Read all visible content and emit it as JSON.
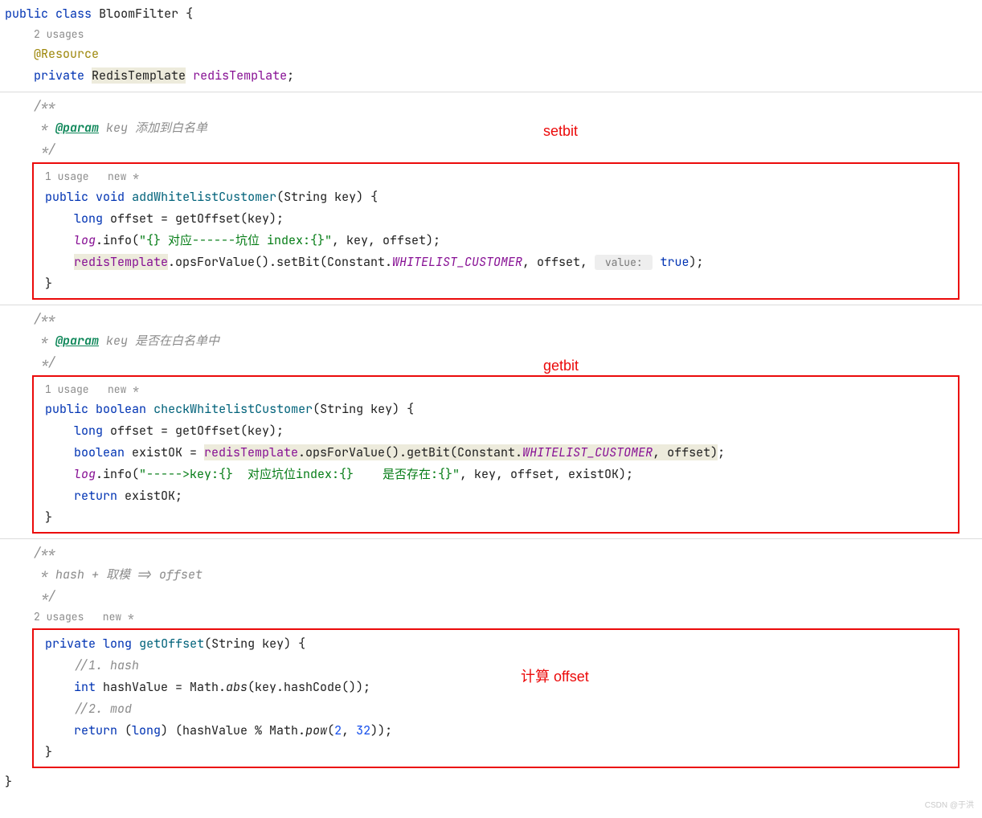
{
  "declLine": {
    "kw1": "public",
    "kw2": "class",
    "name": "BloomFilter",
    "brace": " {"
  },
  "usagesTop": "2 usages",
  "annotation": "@Resource",
  "fieldLine": {
    "kw": "private",
    "type": "RedisTemplate",
    "name": "redisTemplate",
    "semi": ";"
  },
  "doc1": {
    "l1": "/**",
    "l2a": " * ",
    "tag": "@param",
    "l2b": " key 添加到白名单",
    "l3": " */"
  },
  "labelSetbit": "setbit",
  "hint1": "1 usage   new *",
  "m1": {
    "sig_kw1": "public",
    "sig_kw2": "void",
    "sig_name": "addWhitelistCustomer",
    "sig_params": "(String key) {",
    "l1a": "long",
    "l1b": " offset = getOffset(key);",
    "l2a": "log",
    "l2b": ".info(",
    "l2c": "\"{} 对应------坑位 index:{}\"",
    "l2d": ", key, offset);",
    "l3a": "redisTemplate",
    "l3b": ".opsForValue().setBit(Constant.",
    "l3c": "WHITELIST_CUSTOMER",
    "l3d": ", offset, ",
    "l3hint": " value: ",
    "l3e": "true",
    "l3f": ");",
    "close": "}"
  },
  "doc2": {
    "l1": "/**",
    "l2a": " * ",
    "tag": "@param",
    "l2b": " key 是否在白名单中",
    "l3": " */"
  },
  "labelGetbit": "getbit",
  "hint2": "1 usage   new *",
  "m2": {
    "sig_kw1": "public",
    "sig_kw2": "boolean",
    "sig_name": "checkWhitelistCustomer",
    "sig_params": "(String key) {",
    "l1a": "long",
    "l1b": " offset = getOffset(key);",
    "l2a": "boolean",
    "l2b": " existOK = ",
    "l2c": "redisTemplate",
    "l2d": ".opsForValue().getBit(Constant.",
    "l2e": "WHITELIST_CUSTOMER",
    "l2f": ", offset)",
    "l2g": ";",
    "l3a": "log",
    "l3b": ".info(",
    "l3c": "\"----->key:{}  对应坑位index:{}    是否存在:{}\"",
    "l3d": ", key, offset, existOK);",
    "l4a": "return",
    "l4b": " existOK;",
    "close": "}"
  },
  "doc3": {
    "l1": "/**",
    "l2": " * hash + 取模 => offset",
    "l3": " */"
  },
  "hint3": "2 usages   new *",
  "labelOffset": "计算 offset",
  "m3": {
    "sig_kw1": "private",
    "sig_kw2": "long",
    "sig_name": "getOffset",
    "sig_params": "(String key) {",
    "c1": "//1. hash",
    "l1a": "int",
    "l1b": " hashValue = Math.",
    "l1c": "abs",
    "l1d": "(key.hashCode());",
    "c2": "//2. mod",
    "l2a": "return",
    "l2b": " (",
    "l2c": "long",
    "l2d": ") (hashValue % Math.",
    "l2e": "pow",
    "l2f": "(",
    "l2g": "2",
    "l2h": ", ",
    "l2i": "32",
    "l2j": "));",
    "close": "}"
  },
  "closingBrace": "}",
  "watermark": "CSDN @于洪"
}
